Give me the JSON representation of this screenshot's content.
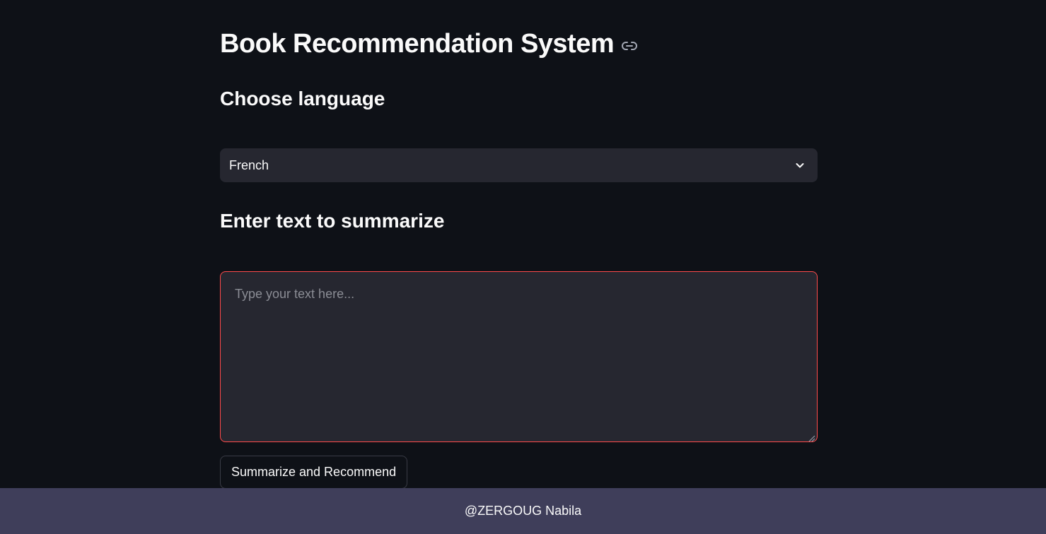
{
  "page": {
    "title": "Book Recommendation System",
    "anchor_icon": "link-icon"
  },
  "language": {
    "subheader": "Choose language",
    "selected": "French",
    "icon": "chevron-down-icon"
  },
  "summarize": {
    "subheader": "Enter text to summarize",
    "placeholder": "Type your text here...",
    "value": "",
    "button_label": "Summarize and Recommend"
  },
  "footer": {
    "text": "@ZERGOUG Nabila"
  },
  "colors": {
    "background": "#0e1117",
    "input_background": "#262730",
    "focus_border": "#ff4b4b",
    "footer_background": "#3f3e5a",
    "text": "#fafafa"
  }
}
